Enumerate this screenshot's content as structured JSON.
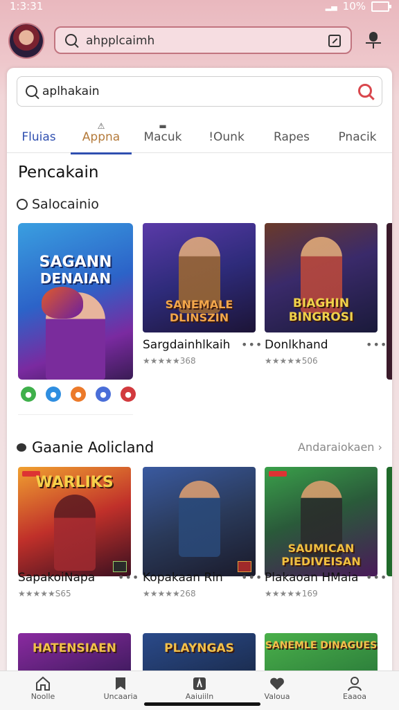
{
  "status": {
    "time": "1:3:31",
    "battery": "10%"
  },
  "top": {
    "search_text": "ahpplcaimh"
  },
  "search": {
    "text": "aplhakain"
  },
  "tabs": [
    {
      "label": "Fluias",
      "icon": ""
    },
    {
      "label": "Appna",
      "icon": "⚠"
    },
    {
      "label": "Macuk",
      "icon": "▬"
    },
    {
      "label": "!Ounk",
      "icon": ""
    },
    {
      "label": "Rapes",
      "icon": ""
    },
    {
      "label": "Pnacik",
      "icon": ""
    }
  ],
  "section1": {
    "title": "Pencakain",
    "subtitle": "Salocainio"
  },
  "featured": {
    "line1": "SAGANN",
    "line2": "DENAIAN"
  },
  "row1": [
    {
      "art": "SANEMALE DLINSZIN",
      "name": "Sargdainhlkaih",
      "rating": "★★★★★368"
    },
    {
      "art": "BIAGHIN BINGROSI",
      "name": "Donlkhand",
      "rating": "★★★★★506"
    }
  ],
  "section2": {
    "title": "Gaanie Aolicland",
    "see_all": "Andaraiokaen"
  },
  "row2": [
    {
      "art": "WARLIKS",
      "name": "SapakoiNapa",
      "rating": "★★★★★S65"
    },
    {
      "art": "",
      "name": "Kopakaan Rin",
      "rating": "★★★★★268"
    },
    {
      "art": "SAUMICAN PIEDIVEISAN",
      "name": "Plakaoan HMaia",
      "rating": "★★★★★169"
    }
  ],
  "row3": [
    {
      "art": "HATENSIAEN"
    },
    {
      "art": "PLAYNGAS"
    },
    {
      "art": "SANEMLE DINAGUES"
    }
  ],
  "nav": [
    {
      "label": "Noolle"
    },
    {
      "label": "Uncaaria"
    },
    {
      "label": "Aaiuiiln"
    },
    {
      "label": "Valoua"
    },
    {
      "label": "Eaaoa"
    }
  ],
  "colors": {
    "accent": "#2f4fb0",
    "search_icon": "#d9474d"
  }
}
